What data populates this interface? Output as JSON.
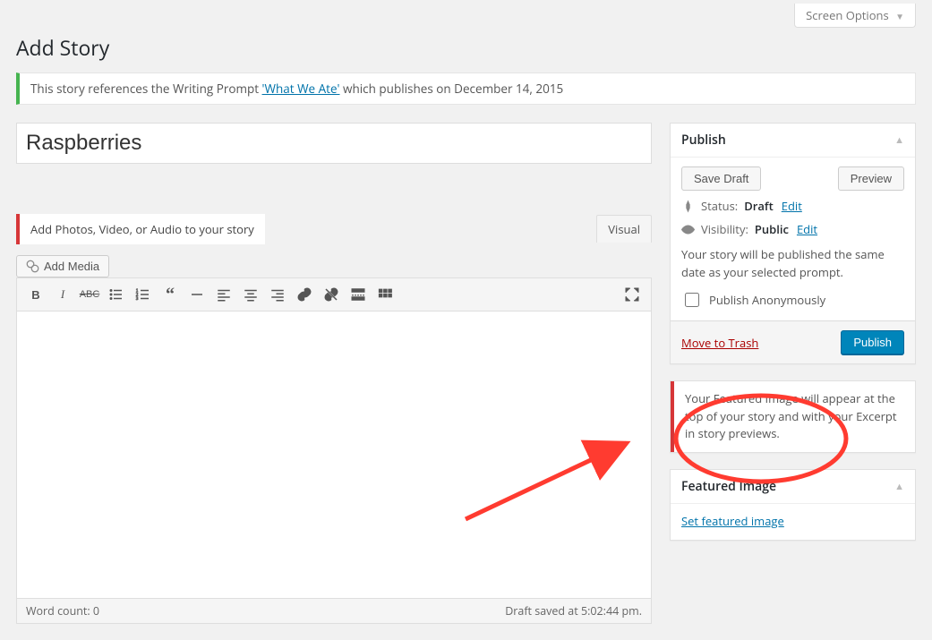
{
  "screen_options": "Screen Options",
  "page_title": "Add Story",
  "notice_prefix": "This story references the Writing Prompt ",
  "notice_link": "'What We Ate'",
  "notice_suffix": " which publishes on December 14, 2015",
  "post_title": "Raspberries",
  "media_hint": "Add Photos, Video, or Audio to your story",
  "add_media_label": "Add Media",
  "editor_tab_visual": "Visual",
  "word_count_label": "Word count: ",
  "word_count_value": "0",
  "draft_saved_text": "Draft saved at 5:02:44 pm.",
  "publish_box": {
    "title": "Publish",
    "save_draft": "Save Draft",
    "preview": "Preview",
    "status_label": "Status:",
    "status_value": "Draft",
    "visibility_label": "Visibility:",
    "visibility_value": "Public",
    "edit": "Edit",
    "note": "Your story will be published the same date as your selected prompt.",
    "anon_label": "Publish Anonymously",
    "trash": "Move to Trash",
    "publish_btn": "Publish"
  },
  "featured_notice": "Your Featured Image will appear at the top of your story and with your Excerpt in story previews.",
  "featured_box": {
    "title": "Featured Image",
    "link": "Set featured image"
  }
}
